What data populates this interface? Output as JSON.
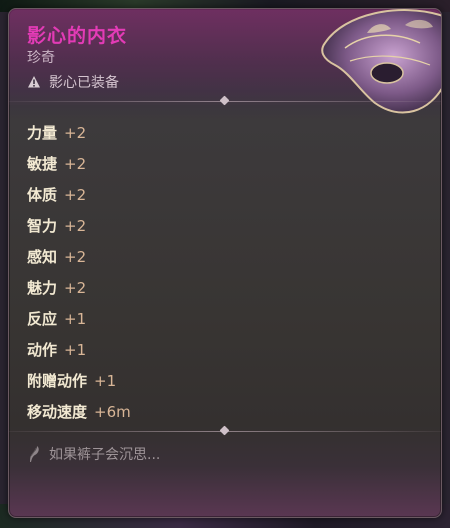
{
  "item": {
    "title": "影心的内衣",
    "rarity": "珍奇",
    "equipped_status": "影心已装备",
    "equipped_icon": "warning-triangle-icon"
  },
  "stats": [
    {
      "name": "力量",
      "value": "+2"
    },
    {
      "name": "敏捷",
      "value": "+2"
    },
    {
      "name": "体质",
      "value": "+2"
    },
    {
      "name": "智力",
      "value": "+2"
    },
    {
      "name": "感知",
      "value": "+2"
    },
    {
      "name": "魅力",
      "value": "+2"
    },
    {
      "name": "反应",
      "value": "+1"
    },
    {
      "name": "动作",
      "value": "+1"
    },
    {
      "name": "附赠动作",
      "value": "+1"
    },
    {
      "name": "移动速度",
      "value": "+6m"
    }
  ],
  "lore": {
    "text": "如果裤子会沉思...",
    "icon": "quill-icon"
  },
  "colors": {
    "title": "#e33bb6",
    "rarity": "#c9b4c4",
    "stat_name": "#f2e9d2",
    "stat_value": "#d9b697",
    "lore": "#9e9498"
  }
}
